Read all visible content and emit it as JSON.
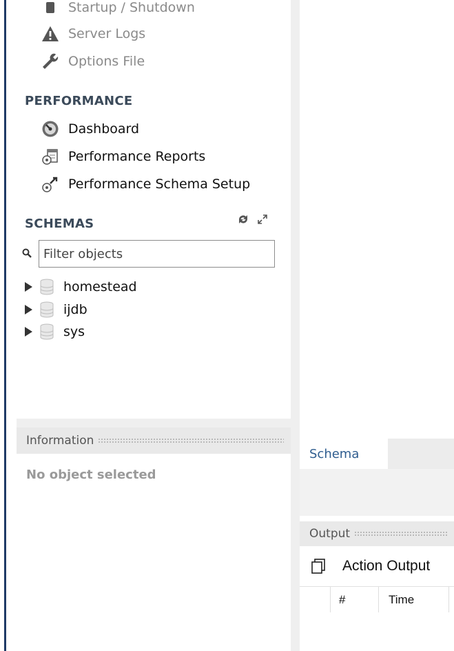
{
  "navigator": {
    "management_items": [
      {
        "label": "Startup / Shutdown",
        "icon": "power-icon",
        "faded": true
      },
      {
        "label": "Server Logs",
        "icon": "warning-icon",
        "faded": true
      },
      {
        "label": "Options File",
        "icon": "wrench-icon",
        "faded": true
      }
    ],
    "performance": {
      "title": "PERFORMANCE",
      "items": [
        {
          "label": "Dashboard",
          "icon": "dashboard-gauge-icon"
        },
        {
          "label": "Performance Reports",
          "icon": "reports-icon"
        },
        {
          "label": "Performance Schema Setup",
          "icon": "schema-setup-icon"
        }
      ]
    },
    "schemas": {
      "title": "SCHEMAS",
      "filter_placeholder": "Filter objects",
      "items": [
        {
          "label": "homestead"
        },
        {
          "label": "ijdb"
        },
        {
          "label": "sys"
        }
      ]
    }
  },
  "information": {
    "title": "Information",
    "empty_text": "No object selected"
  },
  "bottom_tabs": {
    "active": "Schema"
  },
  "output": {
    "title": "Output",
    "selector_value": "Action Output",
    "columns": [
      "#",
      "Time"
    ]
  },
  "colors": {
    "section_title": "#3b4a5a",
    "tab_text": "#2f5d8f",
    "left_border": "#1f3a66"
  }
}
